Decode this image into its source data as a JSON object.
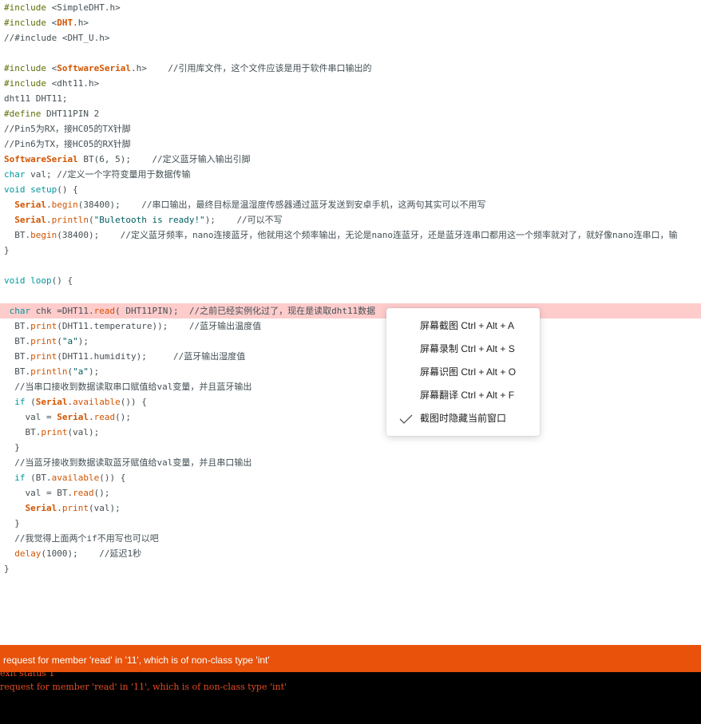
{
  "code_lines": [
    {
      "tokens": [
        {
          "t": "#include ",
          "c": "pre"
        },
        {
          "t": "<SimpleDHT.h>",
          "c": "txt"
        }
      ]
    },
    {
      "tokens": [
        {
          "t": "#include ",
          "c": "pre"
        },
        {
          "t": "<",
          "c": "txt"
        },
        {
          "t": "DHT",
          "c": "cls"
        },
        {
          "t": ".h>",
          "c": "txt"
        }
      ]
    },
    {
      "tokens": [
        {
          "t": "//#include <DHT_U.h>",
          "c": "com"
        }
      ]
    },
    {
      "tokens": []
    },
    {
      "tokens": [
        {
          "t": "#include ",
          "c": "pre"
        },
        {
          "t": "<",
          "c": "txt"
        },
        {
          "t": "SoftwareSerial",
          "c": "cls"
        },
        {
          "t": ".h>    ",
          "c": "txt"
        },
        {
          "t": "//引用库文件，这个文件应该是用于软件串口输出的",
          "c": "com"
        }
      ]
    },
    {
      "tokens": [
        {
          "t": "#include ",
          "c": "pre"
        },
        {
          "t": "<dht11.h>",
          "c": "txt"
        }
      ]
    },
    {
      "tokens": [
        {
          "t": "dht11 DHT11;",
          "c": "txt"
        }
      ]
    },
    {
      "tokens": [
        {
          "t": "#define ",
          "c": "pre"
        },
        {
          "t": "DHT11PIN 2",
          "c": "txt"
        }
      ]
    },
    {
      "tokens": [
        {
          "t": "//Pin5为RX，接HC05的TX针脚",
          "c": "com"
        }
      ]
    },
    {
      "tokens": [
        {
          "t": "//Pin6为TX，接HC05的RX针脚",
          "c": "com"
        }
      ]
    },
    {
      "tokens": [
        {
          "t": "SoftwareSerial",
          "c": "cls"
        },
        {
          "t": " BT(6, 5);    ",
          "c": "txt"
        },
        {
          "t": "//定义蓝牙输入输出引脚",
          "c": "com"
        }
      ]
    },
    {
      "tokens": [
        {
          "t": "char",
          "c": "kw"
        },
        {
          "t": " val; ",
          "c": "txt"
        },
        {
          "t": "//定义一个字符变量用于数据传输",
          "c": "com"
        }
      ]
    },
    {
      "tokens": [
        {
          "t": "void",
          "c": "kw"
        },
        {
          "t": " ",
          "c": "txt"
        },
        {
          "t": "setup",
          "c": "kw"
        },
        {
          "t": "() {",
          "c": "txt"
        }
      ]
    },
    {
      "tokens": [
        {
          "t": "  ",
          "c": "txt"
        },
        {
          "t": "Serial",
          "c": "cls"
        },
        {
          "t": ".",
          "c": "txt"
        },
        {
          "t": "begin",
          "c": "fn"
        },
        {
          "t": "(38400);    ",
          "c": "txt"
        },
        {
          "t": "//串口输出，最终目标是温湿度传感器通过蓝牙发送到安卓手机，这两句其实可以不用写",
          "c": "com"
        }
      ]
    },
    {
      "tokens": [
        {
          "t": "  ",
          "c": "txt"
        },
        {
          "t": "Serial",
          "c": "cls"
        },
        {
          "t": ".",
          "c": "txt"
        },
        {
          "t": "println",
          "c": "fn"
        },
        {
          "t": "(",
          "c": "txt"
        },
        {
          "t": "\"Buletooth is ready!\"",
          "c": "str"
        },
        {
          "t": ");    ",
          "c": "txt"
        },
        {
          "t": "//可以不写",
          "c": "com"
        }
      ]
    },
    {
      "tokens": [
        {
          "t": "  BT.",
          "c": "txt"
        },
        {
          "t": "begin",
          "c": "fn"
        },
        {
          "t": "(38400);    ",
          "c": "txt"
        },
        {
          "t": "//定义蓝牙频率，nano连接蓝牙，他就用这个频率输出，无论是nano连蓝牙，还是蓝牙连串口都用这一个频率就对了，就好像nano连串口，输",
          "c": "com"
        }
      ]
    },
    {
      "tokens": [
        {
          "t": "}",
          "c": "txt"
        }
      ]
    },
    {
      "tokens": []
    },
    {
      "tokens": [
        {
          "t": "void",
          "c": "kw"
        },
        {
          "t": " ",
          "c": "txt"
        },
        {
          "t": "loop",
          "c": "kw"
        },
        {
          "t": "() {",
          "c": "txt"
        }
      ]
    },
    {
      "tokens": []
    },
    {
      "tokens": [
        {
          "t": " ",
          "c": "txt"
        },
        {
          "t": "char",
          "c": "kw"
        },
        {
          "t": " chk =DHT11.",
          "c": "txt"
        },
        {
          "t": "read",
          "c": "fn"
        },
        {
          "t": "( DHT11PIN);  ",
          "c": "txt"
        },
        {
          "t": "//之前已经实例化过了，现在是读取dht11数据",
          "c": "com"
        }
      ],
      "highlight": "true"
    },
    {
      "tokens": [
        {
          "t": "  BT.",
          "c": "txt"
        },
        {
          "t": "print",
          "c": "fn"
        },
        {
          "t": "(DHT11.temperature));    ",
          "c": "txt"
        },
        {
          "t": "//蓝牙输出温度值",
          "c": "com"
        }
      ]
    },
    {
      "tokens": [
        {
          "t": "  BT.",
          "c": "txt"
        },
        {
          "t": "print",
          "c": "fn"
        },
        {
          "t": "(",
          "c": "txt"
        },
        {
          "t": "\"a\"",
          "c": "str"
        },
        {
          "t": ");",
          "c": "txt"
        }
      ]
    },
    {
      "tokens": [
        {
          "t": "  BT.",
          "c": "txt"
        },
        {
          "t": "print",
          "c": "fn"
        },
        {
          "t": "(DHT11.humidity);     ",
          "c": "txt"
        },
        {
          "t": "//蓝牙输出湿度值",
          "c": "com"
        }
      ]
    },
    {
      "tokens": [
        {
          "t": "  BT.",
          "c": "txt"
        },
        {
          "t": "println",
          "c": "fn"
        },
        {
          "t": "(",
          "c": "txt"
        },
        {
          "t": "\"a\"",
          "c": "str"
        },
        {
          "t": ");",
          "c": "txt"
        }
      ]
    },
    {
      "tokens": [
        {
          "t": "  ",
          "c": "txt"
        },
        {
          "t": "//当串口接收到数据读取串口赋值给val变量，并且蓝牙输出",
          "c": "com"
        }
      ]
    },
    {
      "tokens": [
        {
          "t": "  ",
          "c": "txt"
        },
        {
          "t": "if",
          "c": "kw"
        },
        {
          "t": " (",
          "c": "txt"
        },
        {
          "t": "Serial",
          "c": "cls"
        },
        {
          "t": ".",
          "c": "txt"
        },
        {
          "t": "available",
          "c": "fn"
        },
        {
          "t": "()) {",
          "c": "txt"
        }
      ]
    },
    {
      "tokens": [
        {
          "t": "    val = ",
          "c": "txt"
        },
        {
          "t": "Serial",
          "c": "cls"
        },
        {
          "t": ".",
          "c": "txt"
        },
        {
          "t": "read",
          "c": "fn"
        },
        {
          "t": "();",
          "c": "txt"
        }
      ]
    },
    {
      "tokens": [
        {
          "t": "    BT.",
          "c": "txt"
        },
        {
          "t": "print",
          "c": "fn"
        },
        {
          "t": "(val);",
          "c": "txt"
        }
      ]
    },
    {
      "tokens": [
        {
          "t": "  }",
          "c": "txt"
        }
      ]
    },
    {
      "tokens": [
        {
          "t": "  ",
          "c": "txt"
        },
        {
          "t": "//当蓝牙接收到数据读取蓝牙赋值给val变量，并且串口输出",
          "c": "com"
        }
      ]
    },
    {
      "tokens": [
        {
          "t": "  ",
          "c": "txt"
        },
        {
          "t": "if",
          "c": "kw"
        },
        {
          "t": " (BT.",
          "c": "txt"
        },
        {
          "t": "available",
          "c": "fn"
        },
        {
          "t": "()) {",
          "c": "txt"
        }
      ]
    },
    {
      "tokens": [
        {
          "t": "    val = BT.",
          "c": "txt"
        },
        {
          "t": "read",
          "c": "fn"
        },
        {
          "t": "();",
          "c": "txt"
        }
      ]
    },
    {
      "tokens": [
        {
          "t": "    ",
          "c": "txt"
        },
        {
          "t": "Serial",
          "c": "cls"
        },
        {
          "t": ".",
          "c": "txt"
        },
        {
          "t": "print",
          "c": "fn"
        },
        {
          "t": "(val);",
          "c": "txt"
        }
      ]
    },
    {
      "tokens": [
        {
          "t": "  }",
          "c": "txt"
        }
      ]
    },
    {
      "tokens": [
        {
          "t": "  ",
          "c": "txt"
        },
        {
          "t": "//我觉得上面两个if不用写也可以吧",
          "c": "com"
        }
      ]
    },
    {
      "tokens": [
        {
          "t": "  ",
          "c": "txt"
        },
        {
          "t": "delay",
          "c": "fn"
        },
        {
          "t": "(1000);    ",
          "c": "txt"
        },
        {
          "t": "//延迟1秒",
          "c": "com"
        }
      ]
    },
    {
      "tokens": [
        {
          "t": "}",
          "c": "txt"
        }
      ]
    }
  ],
  "context_menu": {
    "items": [
      {
        "label": "屏幕截图 Ctrl + Alt + A",
        "checked": false
      },
      {
        "label": "屏幕录制 Ctrl + Alt + S",
        "checked": false
      },
      {
        "label": "屏幕识图 Ctrl + Alt + O",
        "checked": false
      },
      {
        "label": "屏幕翻译 Ctrl + Alt + F",
        "checked": false
      },
      {
        "label": "截图时隐藏当前窗口",
        "checked": true
      }
    ]
  },
  "error_bar": {
    "message": "request for member 'read' in '11', which is of non-class type 'int'"
  },
  "console": {
    "lines": [
      "exit status 1",
      "request for member 'read' in '11', which is of non-class type 'int'"
    ]
  },
  "colors": {
    "highlight_line": "#ffcccc",
    "error_bar": "#e8520a",
    "console_bg": "#000000",
    "console_text": "#e34c22",
    "keyword": "#00979c",
    "function": "#d35400",
    "preprocessor": "#5e6d03",
    "string": "#005c5f",
    "text": "#434f54"
  }
}
